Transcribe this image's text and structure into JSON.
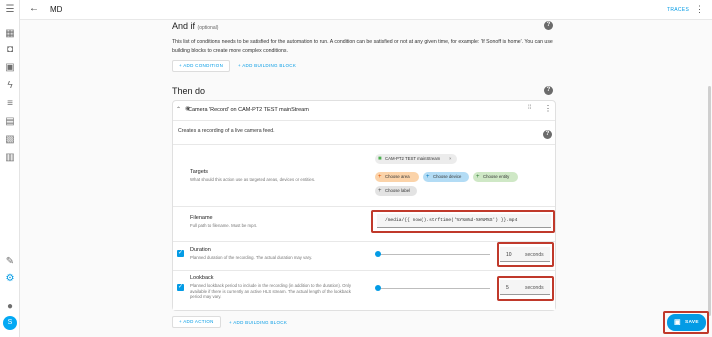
{
  "header": {
    "title": "MD",
    "traces_label": "TRACES"
  },
  "and_if": {
    "heading": "And if",
    "optional": "(optional)",
    "description": "This list of conditions needs to be satisfied for the automation to run. A condition can be satisfied or not at any given time, for example: 'If Sonoff is home'. You can use building blocks to create more complex conditions.",
    "add_condition": "+ ADD CONDITION",
    "add_building_block": "+ ADD BUILDING BLOCK"
  },
  "then_do": {
    "heading": "Then do",
    "action_title": "Camera 'Record' on CAM-PT2 TEST mainStream",
    "action_description": "Creates a recording of a live camera feed.",
    "targets": {
      "label": "Targets",
      "hint": "What should this action use as targeted areas, devices or entities.",
      "selected_chip": "CAM-PT2 TEST mainStream",
      "choose_area": "Choose area",
      "choose_device": "Choose device",
      "choose_entity": "Choose entity",
      "choose_label": "Choose label"
    },
    "filename": {
      "label": "Filename",
      "hint": "Full path to filename. Must be mp4.",
      "value": "/media/{{ now().strftime('%Y%m%d-%H%M%S') }}.mp4"
    },
    "duration": {
      "label": "Duration",
      "hint": "Planned duration of the recording. The actual duration may vary.",
      "value": "10",
      "unit": "seconds",
      "level": 0.0
    },
    "lookback": {
      "label": "Lookback",
      "hint": "Planned lookback period to include in the recording (in addition to the duration). Only available if there is currently an active HLS stream. The actual length of the lookback period may vary.",
      "value": "5",
      "unit": "seconds",
      "level": 0.0
    },
    "add_action": "+ ADD ACTION",
    "add_building_block": "+ ADD BUILDING BLOCK"
  },
  "save_label": "SAVE",
  "user_initial": "S",
  "colors": {
    "accent": "#039be5",
    "highlight": "#c0392b"
  }
}
